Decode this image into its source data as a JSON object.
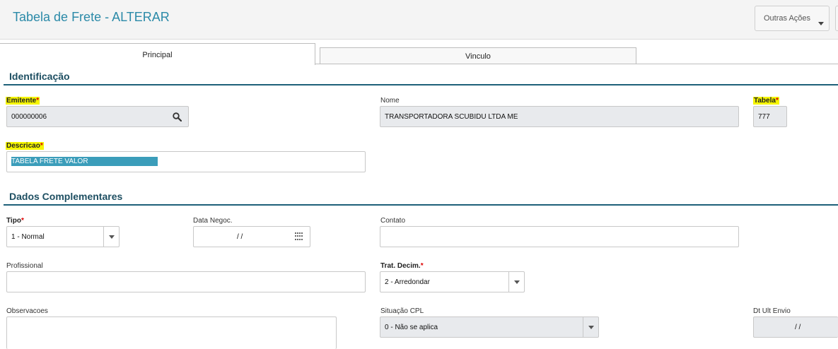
{
  "header": {
    "title": "Tabela de Frete - ALTERAR",
    "actions_label": "Outras Ações"
  },
  "tabs": [
    {
      "label": "Principal"
    },
    {
      "label": "Vinculo"
    }
  ],
  "sections": {
    "identificacao": "Identificação",
    "dados": "Dados Complementares"
  },
  "fields": {
    "emitente": {
      "label": "Emitente",
      "value": "000000006"
    },
    "nome": {
      "label": "Nome",
      "value": "TRANSPORTADORA SCUBIDU LTDA ME"
    },
    "tabela": {
      "label": "Tabela",
      "value": "777"
    },
    "descricao": {
      "label": "Descricao",
      "value": "TABELA FRETE VALOR"
    },
    "tipo": {
      "label": "Tipo",
      "value": "1 - Normal"
    },
    "data_negoc": {
      "label": "Data Negoc.",
      "value": "/ /"
    },
    "contato": {
      "label": "Contato",
      "value": ""
    },
    "profissional": {
      "label": "Profissional",
      "value": ""
    },
    "trat_decim": {
      "label": "Trat. Decim.",
      "value": "2 - Arredondar"
    },
    "observacoes": {
      "label": "Observacoes",
      "value": ""
    },
    "situacao_cpl": {
      "label": "Situação CPL",
      "value": "0 - Não se aplica"
    },
    "dt_ult_envio": {
      "label": "Dt Ult Envio",
      "value": "/ /"
    }
  },
  "required_mark": "*",
  "colors": {
    "title": "#2b8aa8",
    "section": "#1e4f62",
    "highlight": "#f5f500",
    "selection": "#3b9dba"
  }
}
